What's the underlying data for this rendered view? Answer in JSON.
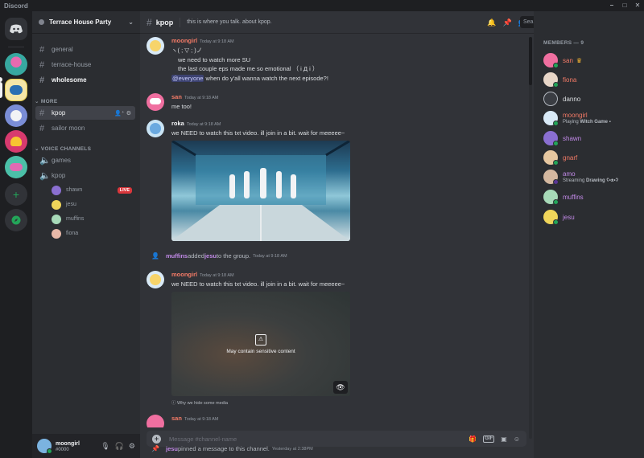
{
  "window": {
    "title": "Discord",
    "controls": [
      "–",
      "□",
      "✕"
    ]
  },
  "server": {
    "name": "Terrace House Party"
  },
  "channels": {
    "text": [
      {
        "name": "general"
      },
      {
        "name": "terrace-house"
      },
      {
        "name": "wholesome"
      }
    ],
    "more_label": "MORE",
    "more": [
      {
        "name": "kpop"
      },
      {
        "name": "sailor moon"
      }
    ],
    "voice_label": "VOICE CHANNELS",
    "voice": [
      {
        "name": "games"
      },
      {
        "name": "kpop"
      }
    ],
    "voice_users": [
      {
        "name": "shawn",
        "badge": "LIVE"
      },
      {
        "name": "jesu"
      },
      {
        "name": "muffins"
      },
      {
        "name": "fiona"
      }
    ]
  },
  "user": {
    "name": "moongirl",
    "tag": "#0000"
  },
  "channel_header": {
    "name": "kpop",
    "topic": "this is where you talk. about kpop."
  },
  "search": {
    "placeholder": "Search"
  },
  "messages": [
    {
      "author": "moongirl",
      "time": "Today at 9:18 AM",
      "lines": [
        "ヽ( ; ▽ ; )ノ",
        "we need to watch more SU",
        "the last couple eps made me so emotional （ i Д i ）"
      ],
      "mention": "@everyone",
      "mention_rest": " when do y'all wanna watch the next episode?!"
    },
    {
      "author": "san",
      "time": "Today at 9:18 AM",
      "lines": [
        "me too!"
      ]
    },
    {
      "author": "roka",
      "time": "Today at 9:18 AM",
      "lines": [
        "we NEED to watch this txt video. ill join in a bit. wait for meeeee~"
      ]
    },
    {
      "author": "moongirl",
      "time": "Today at 9:18 AM",
      "lines": [
        "we NEED to watch this txt video. ill join in a bit. wait for meeeee~"
      ]
    },
    {
      "author": "san",
      "time": "Today at 9:18 AM",
      "lines": []
    }
  ],
  "system_added": {
    "actor": "muffins",
    "action": " added ",
    "target": "jesu",
    "rest": " to the group.",
    "time": "Today at 9:18 AM"
  },
  "system_pinned": {
    "actor": "jesu",
    "rest": " pinned a message to this channel.",
    "time": "Yesterday at 2:38PM"
  },
  "sensitive": {
    "label": "May contain sensitive content",
    "why": "Why we hide some media"
  },
  "composer": {
    "placeholder": "Message #channel-name"
  },
  "members": {
    "header": "MEMBERS — 9",
    "list": [
      {
        "name": "san",
        "color": "#f47b67"
      },
      {
        "name": "fiona",
        "color": "#f47b67"
      },
      {
        "name": "danno",
        "color": "#dbdee1"
      },
      {
        "name": "moongirl",
        "color": "#f47b67",
        "activity_prefix": "Playing ",
        "activity": "Witch Game"
      },
      {
        "name": "shawn",
        "color": "#c28ae8"
      },
      {
        "name": "gnarf",
        "color": "#f47b67"
      },
      {
        "name": "amo",
        "color": "#c28ae8",
        "activity_prefix": "Streaming ",
        "activity": "Drawing ʕ•ᴥ•ʔ"
      },
      {
        "name": "muffins",
        "color": "#c28ae8"
      },
      {
        "name": "jesu",
        "color": "#c28ae8"
      }
    ]
  },
  "colors": {
    "author_pink": "#f47b67",
    "author_white": "#f2f3f5",
    "online": "#23a559",
    "live": "#da373c"
  }
}
